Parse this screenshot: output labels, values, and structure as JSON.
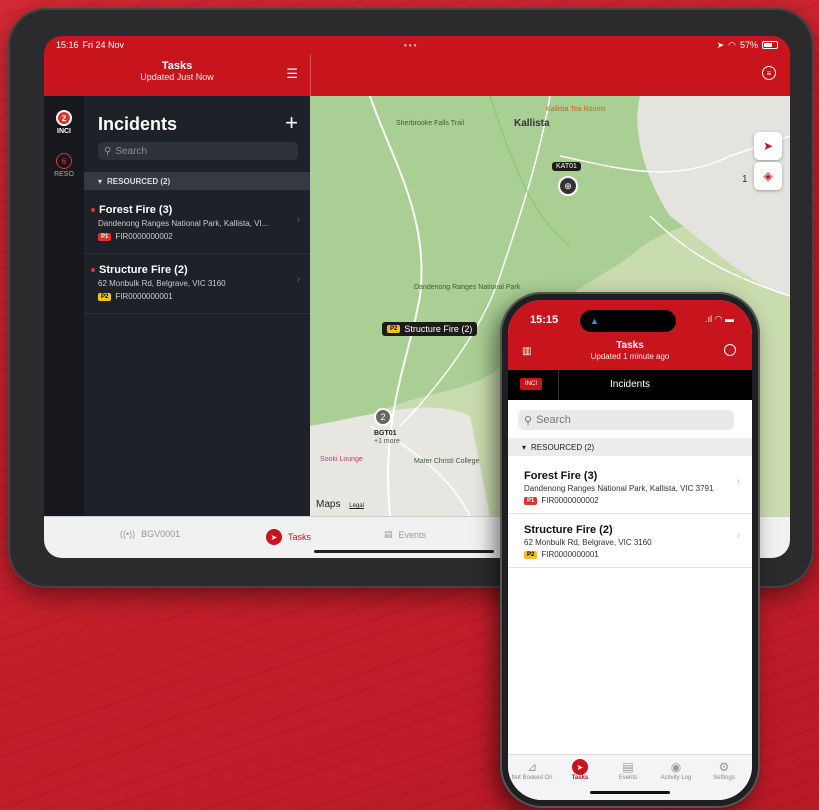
{
  "tablet": {
    "status": {
      "time": "15:16",
      "date": "Fri 24 Nov",
      "battery": "57%"
    },
    "header": {
      "title": "Tasks",
      "subtitle": "Updated Just Now"
    },
    "rail": [
      {
        "count": "2",
        "label": "INCI"
      },
      {
        "count": "6",
        "label": "RESO"
      }
    ],
    "list": {
      "heading": "Incidents",
      "search_placeholder": "Search",
      "section": "RESOURCED (2)",
      "items": [
        {
          "name": "Forest Fire (3)",
          "address": "Dandenong Ranges National Park, Kallista, VI...",
          "priority": "P1",
          "code": "FIR0000000002"
        },
        {
          "name": "Structure Fire (2)",
          "address": "62 Monbulk Rd, Belgrave, VIC 3160",
          "priority": "P2",
          "code": "FIR0000000001"
        }
      ]
    },
    "map": {
      "town": "Kallista",
      "town_2": "1",
      "labels": [
        "Sherbrooke Falls Trail",
        "Kallista Tea Rooms",
        "Dandenong Ranges National Park",
        "Sooki Lounge",
        "Mater Christi College"
      ],
      "vehicle_label": "KAT01",
      "callout_priority": "P2",
      "callout_text": "Structure Fire (2)",
      "cluster_count": "2",
      "cluster_label": "BGT01",
      "cluster_more": "+1 more",
      "brand": "Maps",
      "legal": "Legal"
    },
    "tabbar": [
      {
        "label": "BGV0001"
      },
      {
        "label": "Tasks"
      },
      {
        "label": "Events"
      }
    ]
  },
  "phone": {
    "status": {
      "time": "15:15"
    },
    "header": {
      "title": "Tasks",
      "subtitle": "Updated 1 minute ago"
    },
    "tabs": {
      "badge": "INCI",
      "label": "Incidents"
    },
    "list": {
      "search_placeholder": "Search",
      "section": "RESOURCED (2)",
      "items": [
        {
          "name": "Forest Fire (3)",
          "address": "Dandenong Ranges National Park, Kallista, VIC 3791",
          "priority": "P1",
          "code": "FIR0000000002"
        },
        {
          "name": "Structure Fire (2)",
          "address": "62 Monbulk Rd, Belgrave, VIC 3160",
          "priority": "P2",
          "code": "FIR0000000001"
        }
      ]
    },
    "tabbar": [
      {
        "label": "Not Booked On"
      },
      {
        "label": "Tasks"
      },
      {
        "label": "Events"
      },
      {
        "label": "Activity Log"
      },
      {
        "label": "Settings"
      }
    ]
  },
  "colors": {
    "brand": "#c8151d",
    "p1": "#e3312f",
    "p2": "#f4c01b"
  }
}
